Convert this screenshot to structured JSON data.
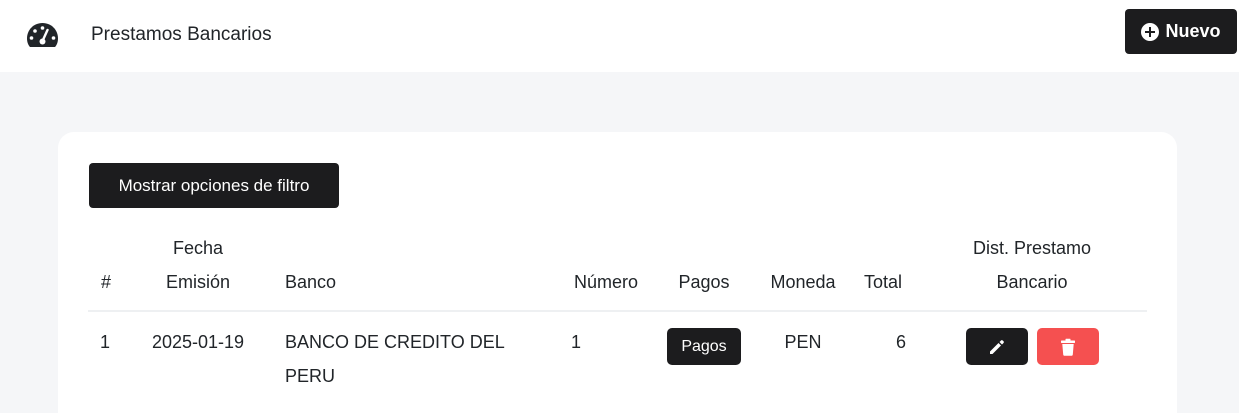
{
  "header": {
    "title": "Prestamos Bancarios",
    "new_button": "Nuevo",
    "gauge_icon": "dashboard-gauge-icon",
    "plus_icon": "plus-circle-icon"
  },
  "filter": {
    "button_label": "Mostrar opciones de filtro"
  },
  "table": {
    "columns": {
      "index": "#",
      "fecha_line1": "Fecha",
      "fecha_line2": "Emisión",
      "banco": "Banco",
      "numero": "Número",
      "pagos": "Pagos",
      "moneda": "Moneda",
      "total": "Total",
      "dist_line1": "Dist. Prestamo",
      "dist_line2": "Bancario"
    },
    "rows": [
      {
        "index": "1",
        "fecha": "2025-01-19",
        "banco_line1": "BANCO DE CREDITO DEL",
        "banco_line2": "PERU",
        "numero": "1",
        "pagos_button": "Pagos",
        "moneda": "PEN",
        "total": "6",
        "edit_icon": "pencil-icon",
        "delete_icon": "trash-icon"
      }
    ]
  },
  "colors": {
    "dark_button": "#1c1c1e",
    "danger_button": "#f55050",
    "page_background": "#f5f6f8"
  }
}
